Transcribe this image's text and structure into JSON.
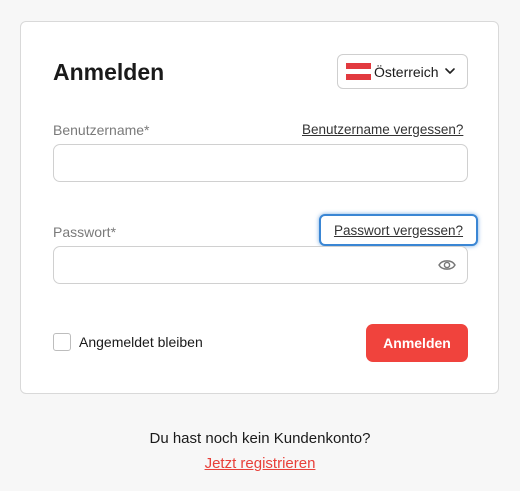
{
  "login": {
    "title": "Anmelden",
    "country": "Österreich",
    "username_label": "Benutzername*",
    "username_forgot": "Benutzername vergessen?",
    "username_value": "",
    "password_label": "Passwort*",
    "password_forgot": "Passwort vergessen?",
    "password_value": "",
    "remember_label": "Angemeldet bleiben",
    "submit_label": "Anmelden"
  },
  "footer": {
    "no_account": "Du hast noch kein Kundenkonto?",
    "register_link": "Jetzt registrieren"
  },
  "icons": {
    "flag": "austria-flag-icon",
    "chevron": "chevron-down-icon",
    "eye": "eye-icon"
  },
  "colors": {
    "accent": "#f0433d",
    "focus": "#3a86d4",
    "link_red": "#e8403a"
  }
}
